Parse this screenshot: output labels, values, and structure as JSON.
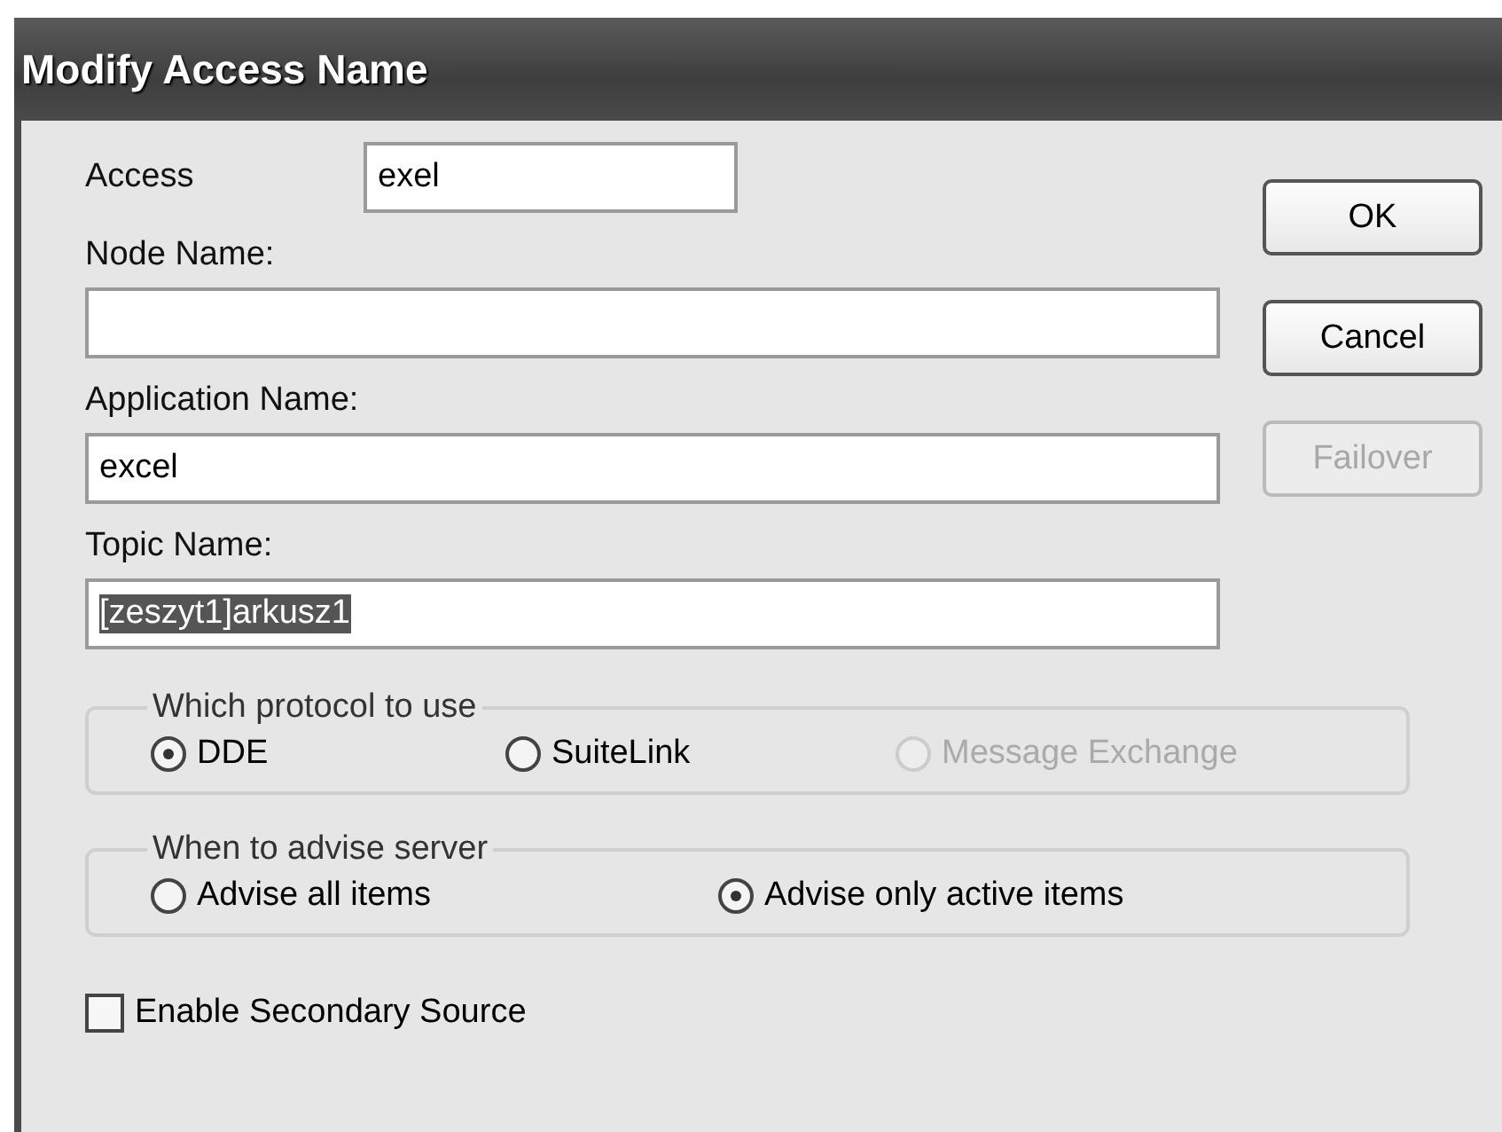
{
  "window": {
    "title": "Modify Access Name"
  },
  "fields": [
    {
      "kind": "inline",
      "label": "Access",
      "value": "exel",
      "text_selected": false
    },
    {
      "kind": "stacked",
      "label": "Node Name:"
    },
    {
      "kind": "stacked",
      "label": "Application Name:",
      "value": "excel",
      "text_selected": false
    },
    {
      "kind": "stacked",
      "label": "Topic Name:",
      "value": "[zeszyt1]arkusz1",
      "text_selected": true
    }
  ],
  "buttons": [
    {
      "label": "OK",
      "disabled": false
    },
    {
      "label": "Cancel",
      "disabled": false
    },
    {
      "label": "Failover",
      "disabled": true
    }
  ],
  "groups": [
    {
      "title": "Which protocol to use",
      "options": [
        {
          "label": "DDE",
          "selected": true,
          "disabled": false
        },
        {
          "label": "SuiteLink",
          "selected": false,
          "disabled": false
        },
        {
          "label": "Message Exchange",
          "selected": false,
          "disabled": true
        }
      ]
    },
    {
      "title": "When to advise server",
      "options": [
        {
          "label": "Advise all items",
          "selected": false,
          "disabled": false
        },
        {
          "label": "Advise only active items",
          "selected": true,
          "disabled": false
        }
      ]
    }
  ],
  "checkbox": {
    "label": "Enable Secondary Source",
    "checked": false
  }
}
